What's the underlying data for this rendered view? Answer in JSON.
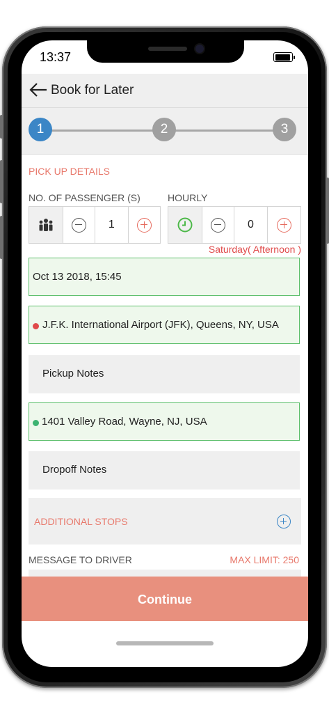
{
  "status_bar": {
    "time": "13:37"
  },
  "header": {
    "title": "Book for Later"
  },
  "steps": [
    {
      "label": "1",
      "active": true
    },
    {
      "label": "2",
      "active": false
    },
    {
      "label": "3",
      "active": false
    }
  ],
  "pickup": {
    "section_title": "PICK UP DETAILS",
    "passenger_label": "NO. OF PASSENGER (S)",
    "passenger_count": "1",
    "hourly_label": "HOURLY",
    "hourly_count": "0",
    "day_hint": "Saturday( Afternoon )",
    "datetime": "Oct 13 2018, 15:45",
    "pickup_location": "J.F.K. International Airport (JFK), Queens, NY, USA",
    "pickup_notes_placeholder": "Pickup Notes",
    "dropoff_location": "1401 Valley Road, Wayne, NJ, USA",
    "dropoff_notes_placeholder": "Dropoff Notes",
    "additional_stops_label": "ADDITIONAL STOPS",
    "message_label": "MESSAGE TO DRIVER",
    "max_limit": "MAX LIMIT: 250"
  },
  "footer": {
    "continue_label": "Continue"
  },
  "colors": {
    "accent_red": "#e8796c",
    "active_step": "#3b86c6",
    "pickup_dot": "#e04a4a",
    "dropoff_dot": "#3cb371",
    "continue_bg": "#e8907e"
  }
}
